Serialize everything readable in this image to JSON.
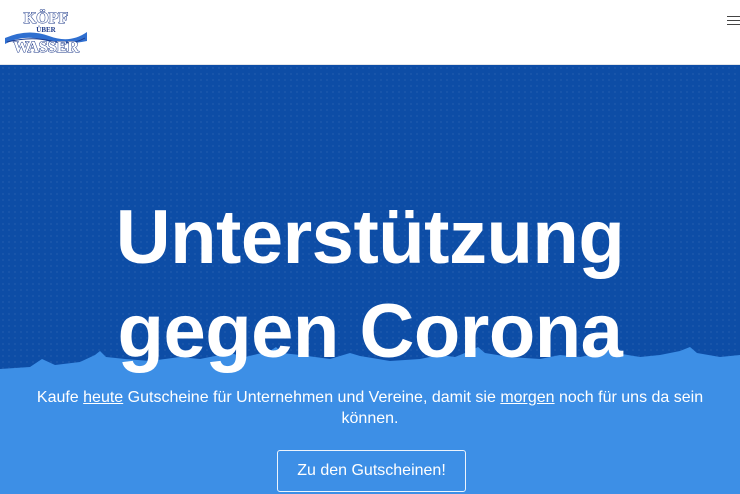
{
  "logo": {
    "line1": "KÖPF",
    "line2": "ÜBER",
    "line3": "WASSER"
  },
  "header": {
    "menu_icon": "hamburger-menu-icon"
  },
  "hero": {
    "title_line1": "Unterstützung",
    "title_line2": "gegen Corona",
    "subtitle": {
      "part1": "Kaufe ",
      "link1": "heute",
      "part2": " Gutscheine für Unternehmen und Vereine, damit sie ",
      "link2": "morgen",
      "part3": " noch für uns da sein können."
    },
    "cta_label": "Zu den Gutscheinen!"
  },
  "colors": {
    "hero_dark": "#0d4da6",
    "hero_light": "#3d8fe6",
    "text": "#ffffff"
  }
}
